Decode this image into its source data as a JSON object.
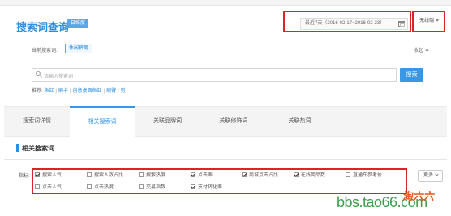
{
  "header": {
    "title": "搜索词查询",
    "badge": "日维度",
    "date_range": "最近7天（2016-02-17~2016-02-23）",
    "terminal": "无线端"
  },
  "current": {
    "label": "当前搜索词:",
    "term": "休闲裤男",
    "collapse": "收起"
  },
  "search": {
    "placeholder": "请输入搜索词",
    "button": "搜索"
  },
  "recommend": {
    "label": "推荐:",
    "items": [
      "鱼缸",
      "刷卡",
      "创意桌面鱼缸",
      "刷臂",
      "剪"
    ]
  },
  "tabs": [
    {
      "label": "搜索词详情",
      "active": false
    },
    {
      "label": "相关搜索词",
      "active": true
    },
    {
      "label": "关联品牌词",
      "active": false
    },
    {
      "label": "关联修饰词",
      "active": false
    },
    {
      "label": "关联热词",
      "active": false
    }
  ],
  "section": {
    "title": "相关搜索词"
  },
  "metrics": {
    "label": "指标:",
    "items": [
      {
        "label": "搜索人气",
        "checked": true
      },
      {
        "label": "搜索人数占比",
        "checked": false
      },
      {
        "label": "搜索热度",
        "checked": false
      },
      {
        "label": "点击率",
        "checked": true
      },
      {
        "label": "商城点击占比",
        "checked": true
      },
      {
        "label": "在线商品数",
        "checked": true
      },
      {
        "label": "直通车参考价",
        "checked": false
      },
      {
        "label": "点击人气",
        "checked": false
      },
      {
        "label": "点击热度",
        "checked": false
      },
      {
        "label": "交易指数",
        "checked": false
      },
      {
        "label": "支付转化率",
        "checked": true
      }
    ],
    "more": "更多"
  },
  "watermark": {
    "url": "bbs.tao66.com",
    "brand": "淘六六"
  }
}
